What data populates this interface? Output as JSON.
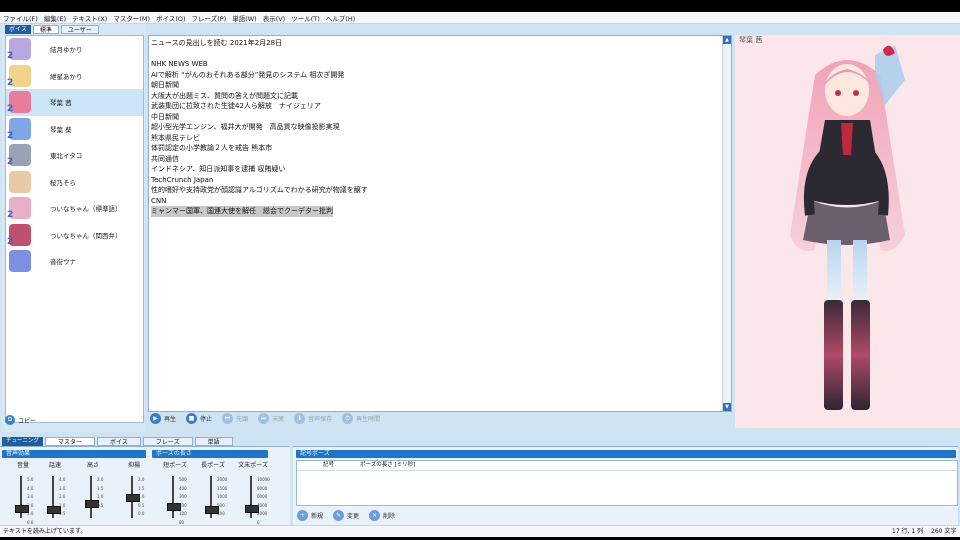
{
  "menu": [
    "ファイル(F)",
    "編集(E)",
    "テキスト(X)",
    "マスター(M)",
    "ボイス(O)",
    "フレーズ(P)",
    "単語(W)",
    "表示(V)",
    "ツール(T)",
    "ヘルプ(H)"
  ],
  "voice_tabs": {
    "label": "ボイス",
    "tabs": [
      "標準",
      "ユーザー"
    ]
  },
  "voices": [
    {
      "name": "結月ゆかり",
      "color": "#b9a7e0",
      "level": "2"
    },
    {
      "name": "紲星あかり",
      "color": "#f2d38c",
      "level": "2"
    },
    {
      "name": "琴葉 茜",
      "color": "#e77d9a",
      "level": "2"
    },
    {
      "name": "琴葉 葵",
      "color": "#7fa6e6",
      "level": "2"
    },
    {
      "name": "東北イタコ",
      "color": "#9aa2b8",
      "level": "2"
    },
    {
      "name": "桜乃そら",
      "color": "#e8c9a8",
      "level": ""
    },
    {
      "name": "ついなちゃん（標準語）",
      "color": "#e6b0c8",
      "level": "2"
    },
    {
      "name": "ついなちゃん（関西弁）",
      "color": "#c05070",
      "level": "2"
    },
    {
      "name": "音街ウナ",
      "color": "#7d8fe0",
      "level": ""
    }
  ],
  "copy_label": "コピー",
  "editor_lines": [
    "ニュースの見出しを読む 2021年2月28日",
    "",
    "NHK NEWS WEB",
    "AIで解析 “がんのおそれある部分”発見のシステム 相次ぎ開発",
    "朝日新聞",
    "大阪大が出題ミス、質問の答えが問題文に記載",
    "武装集団に拉致された生徒42人ら解放　ナイジェリア",
    "中日新聞",
    "超小型光学エンジン、福井大が開発　高品質な映像投影実現",
    "熊本県民テレビ",
    "体罰認定の小学教諭２人を戒告 熊本市",
    "共同通信",
    "インドネシア、知日派知事を逮捕 収賄疑い",
    "TechCrunch Japan",
    "性的嗜好や支持政党が顔認識アルゴリズムでわかる研究が物議を醸す",
    "CNN",
    "ミャンマー国軍、国連大使を解任　総会でクーデター批判"
  ],
  "playbar": [
    {
      "label": "再生",
      "icon": "play-icon",
      "enabled": true
    },
    {
      "label": "停止",
      "icon": "stop-icon",
      "enabled": true
    },
    {
      "label": "先頭",
      "icon": "rewind-icon",
      "enabled": false
    },
    {
      "label": "末尾",
      "icon": "forward-icon",
      "enabled": false
    },
    {
      "label": "音声保存",
      "icon": "save-audio-icon",
      "enabled": false
    },
    {
      "label": "再生時間",
      "icon": "timer-icon",
      "enabled": false
    }
  ],
  "character_name": "琴葉 茜",
  "bottom_tabs": {
    "label": "チューニング",
    "tabs": [
      "マスター",
      "ボイス",
      "フレーズ",
      "単語"
    ]
  },
  "sections": {
    "voice_effect": "音声効果",
    "pause_length": "ポーズの長さ",
    "symbol_pause": "記号ポーズ"
  },
  "sliders": [
    {
      "label": "音量",
      "ticks": [
        "5.0",
        "4.0",
        "3.0",
        "2.0",
        "1.0",
        "0.0"
      ],
      "level": 0.2
    },
    {
      "label": "話速",
      "ticks": [
        "4.0",
        "3.0",
        "2.0",
        "1.0",
        "0.5"
      ],
      "level": 0.17
    },
    {
      "label": "高さ",
      "ticks": [
        "2.0",
        "1.5",
        "1.0",
        "0.5"
      ],
      "level": 0.33
    },
    {
      "label": "抑揚",
      "ticks": [
        "2.0",
        "1.5",
        "1.0",
        "0.5",
        "0.0"
      ],
      "level": 0.5
    },
    {
      "label": "短ポーズ",
      "ticks": [
        "500",
        "400",
        "300",
        "200",
        "100",
        "80"
      ],
      "level": 0.25
    },
    {
      "label": "長ポーズ",
      "ticks": [
        "2000",
        "1500",
        "1000",
        "500",
        "100"
      ],
      "level": 0.17
    },
    {
      "label": "文末ポーズ",
      "ticks": [
        "10000",
        "8000",
        "6000",
        "4000",
        "2000",
        "0"
      ],
      "level": 0.2
    }
  ],
  "symbol_table": {
    "col1": "記号",
    "col2": "ポーズの長さ [ミリ秒]"
  },
  "symbol_buttons": [
    "新規",
    "変更",
    "削除"
  ],
  "status": {
    "message": "テキストを読み上げています。",
    "position": "17 行, 1 列",
    "chars": "260 文字"
  }
}
